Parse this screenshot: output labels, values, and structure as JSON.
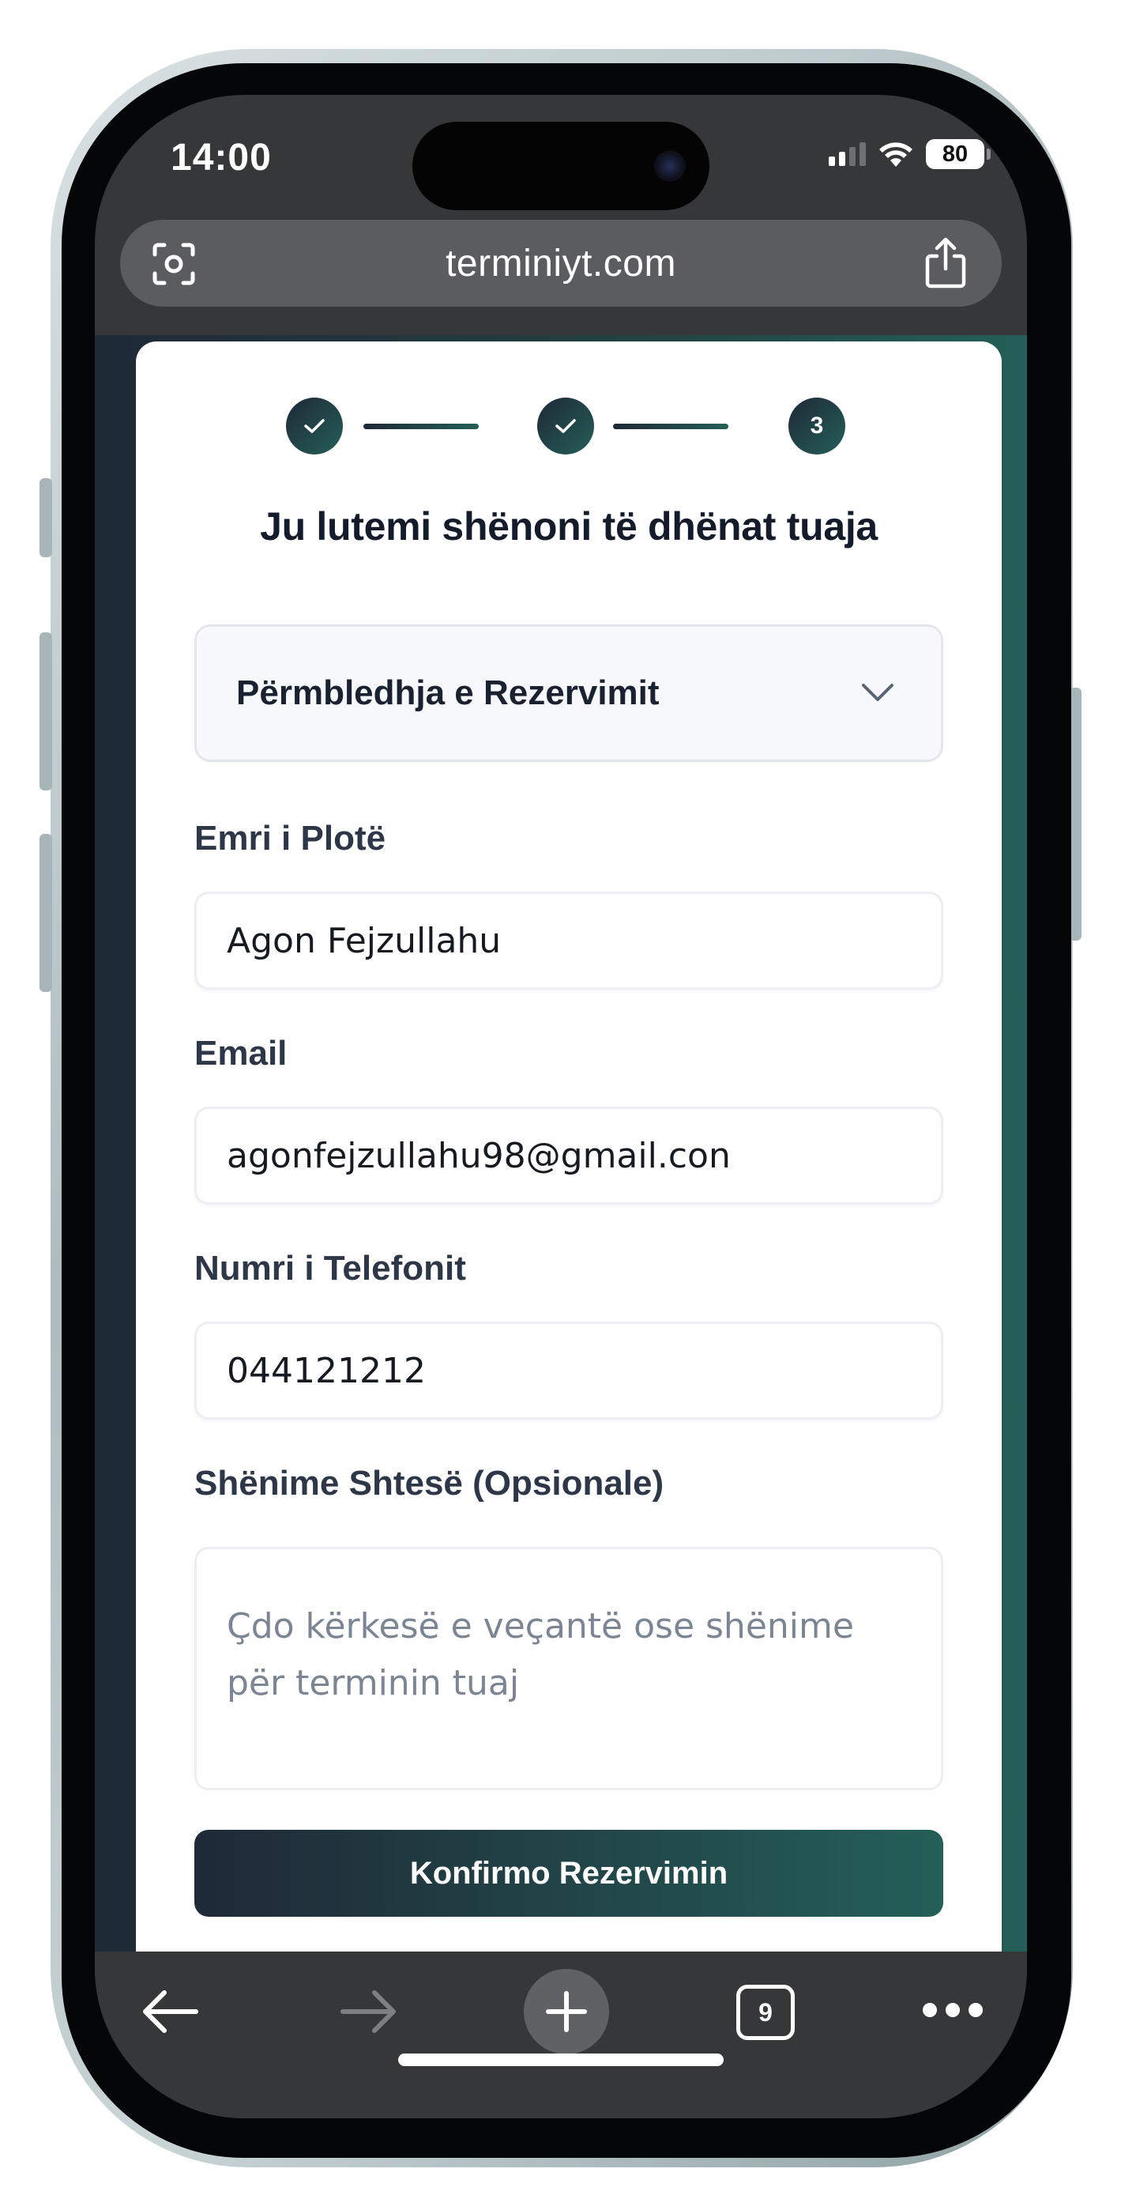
{
  "status_bar": {
    "time": "14:00",
    "battery": "80",
    "signal_bars_active": 2,
    "signal_bars_total": 4
  },
  "browser": {
    "url": "terminiyt.com",
    "tab_count": "9",
    "icons": {
      "lens": "visual-lookup-icon",
      "share": "share-icon",
      "back": "back-arrow-icon",
      "forward": "forward-arrow-icon",
      "new_tab": "plus-icon",
      "tabs": "tabs-icon",
      "more": "more-icon"
    }
  },
  "stepper": {
    "steps": [
      {
        "state": "done",
        "label": ""
      },
      {
        "state": "done",
        "label": ""
      },
      {
        "state": "current",
        "label": "3"
      }
    ]
  },
  "form": {
    "title": "Ju lutemi shënoni të dhënat tuaja",
    "summary_label": "Përmbledhja e Rezervimit",
    "full_name": {
      "label": "Emri i Plotë",
      "value": "Agon Fejzullahu"
    },
    "email": {
      "label": "Email",
      "value": "agonfejzullahu98@gmail.con"
    },
    "phone": {
      "label": "Numri i Telefonit",
      "value": "044121212"
    },
    "notes": {
      "label": "Shënime Shtesë (Opsionale)",
      "placeholder": "Çdo kërkesë e veçantë ose shënime për terminin tuaj"
    },
    "submit_label": "Konfirmo Rezervimin"
  },
  "colors": {
    "accent_start": "#1f2937",
    "accent_end": "#245f58",
    "toolbar": "#363739"
  }
}
